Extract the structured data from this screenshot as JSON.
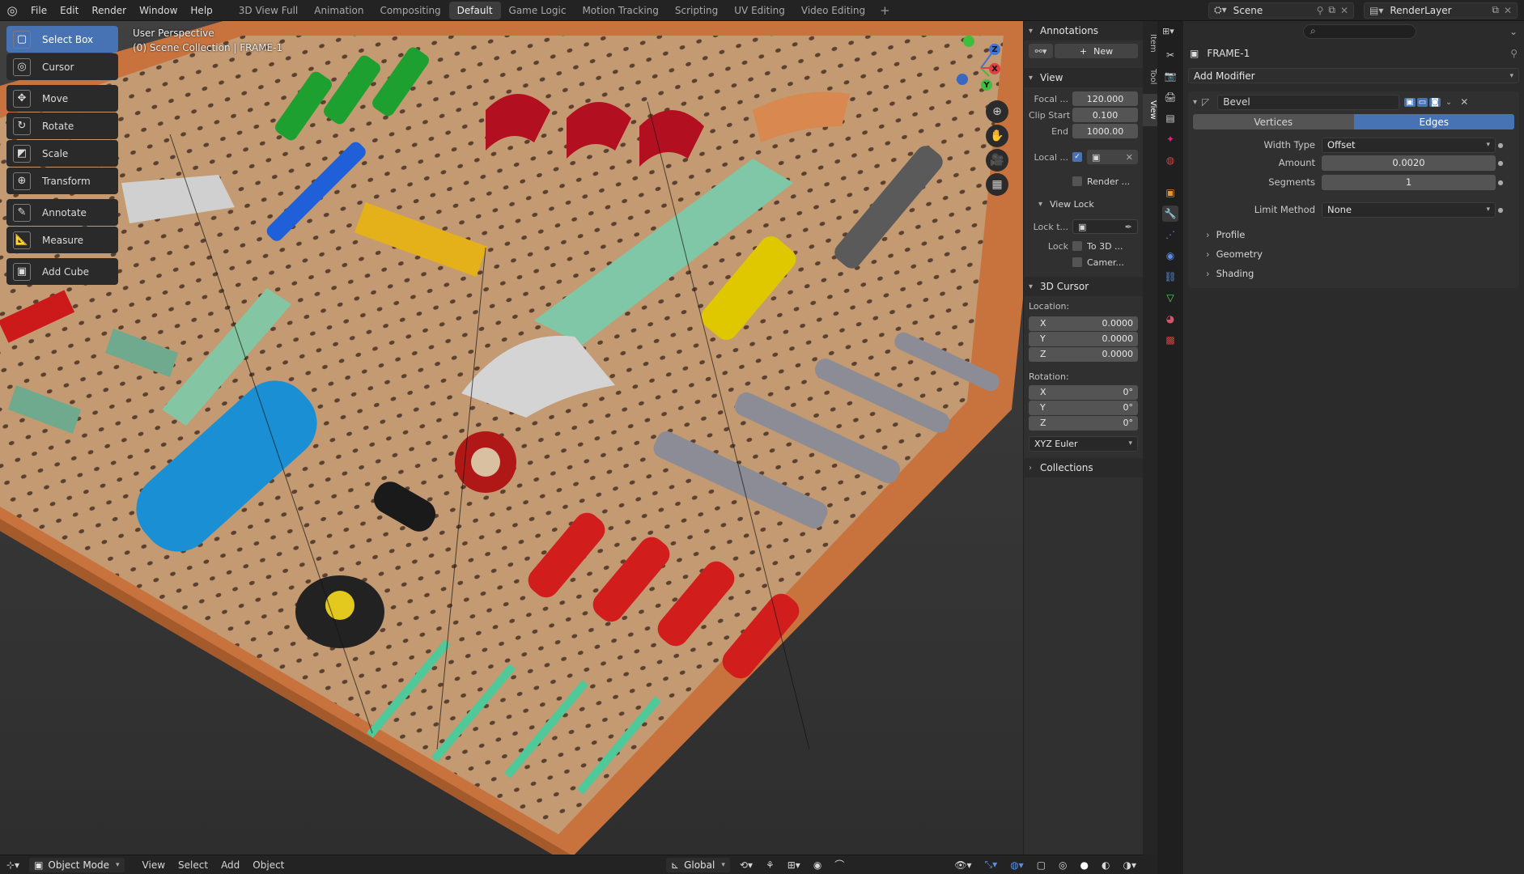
{
  "menu": [
    "File",
    "Edit",
    "Render",
    "Window",
    "Help"
  ],
  "workspaces": [
    {
      "label": "3D View Full",
      "active": false
    },
    {
      "label": "Animation",
      "active": false
    },
    {
      "label": "Compositing",
      "active": false
    },
    {
      "label": "Default",
      "active": true
    },
    {
      "label": "Game Logic",
      "active": false
    },
    {
      "label": "Motion Tracking",
      "active": false
    },
    {
      "label": "Scripting",
      "active": false
    },
    {
      "label": "UV Editing",
      "active": false
    },
    {
      "label": "Video Editing",
      "active": false
    }
  ],
  "add_workspace": "+",
  "scene": {
    "label": "Scene"
  },
  "view_layer": {
    "label": "RenderLayer"
  },
  "viewport": {
    "title": "User Perspective",
    "subtitle": "(0) Scene Collection | FRAME-1",
    "gizmo": {
      "x": "X",
      "y": "Y",
      "z": "Z"
    }
  },
  "tools": [
    {
      "label": "Select Box",
      "icon": "▢",
      "selected": true,
      "gap": false
    },
    {
      "label": "Cursor",
      "icon": "◎",
      "selected": false,
      "gap": false
    },
    {
      "label": "Move",
      "icon": "✥",
      "selected": false,
      "gap": true
    },
    {
      "label": "Rotate",
      "icon": "↻",
      "selected": false,
      "gap": false
    },
    {
      "label": "Scale",
      "icon": "◩",
      "selected": false,
      "gap": false
    },
    {
      "label": "Transform",
      "icon": "⊕",
      "selected": false,
      "gap": false
    },
    {
      "label": "Annotate",
      "icon": "✎",
      "selected": false,
      "gap": true
    },
    {
      "label": "Measure",
      "icon": "📐",
      "selected": false,
      "gap": false
    },
    {
      "label": "Add Cube",
      "icon": "▣",
      "selected": false,
      "gap": true
    }
  ],
  "npanel": {
    "annotations": {
      "title": "Annotations",
      "new_label": "New"
    },
    "view": {
      "title": "View",
      "focal_label": "Focal ...",
      "focal": "120.000",
      "clip_start_label": "Clip Start",
      "clip_start": "0.100",
      "end_label": "End",
      "end": "1000.00",
      "local_label": "Local ...",
      "render_label": "Render ...",
      "view_lock_title": "View Lock",
      "lock_to_label": "Lock t...",
      "lock_label": "Lock",
      "to3d_label": "To 3D ...",
      "camera_label": "Camer..."
    },
    "cursor": {
      "title": "3D Cursor",
      "location_label": "Location:",
      "loc": [
        {
          "axis": "X",
          "value": "0.0000"
        },
        {
          "axis": "Y",
          "value": "0.0000"
        },
        {
          "axis": "Z",
          "value": "0.0000"
        }
      ],
      "rotation_label": "Rotation:",
      "rot": [
        {
          "axis": "X",
          "value": "0°"
        },
        {
          "axis": "Y",
          "value": "0°"
        },
        {
          "axis": "Z",
          "value": "0°"
        }
      ],
      "mode": "XYZ Euler"
    },
    "collections": {
      "title": "Collections"
    }
  },
  "side_tabs": [
    "Item",
    "Tool",
    "View"
  ],
  "properties": {
    "object_name": "FRAME-1",
    "add_modifier": "Add Modifier",
    "modifier": {
      "name": "Bevel",
      "tab_vertices": "Vertices",
      "tab_edges": "Edges",
      "width_type_label": "Width Type",
      "width_type": "Offset",
      "amount_label": "Amount",
      "amount": "0.0020",
      "segments_label": "Segments",
      "segments": "1",
      "limit_label": "Limit Method",
      "limit": "None",
      "subpanels": [
        "Profile",
        "Geometry",
        "Shading"
      ]
    }
  },
  "bottombar": {
    "mode": "Object Mode",
    "menus": [
      "View",
      "Select",
      "Add",
      "Object"
    ],
    "orientation": "Global"
  }
}
